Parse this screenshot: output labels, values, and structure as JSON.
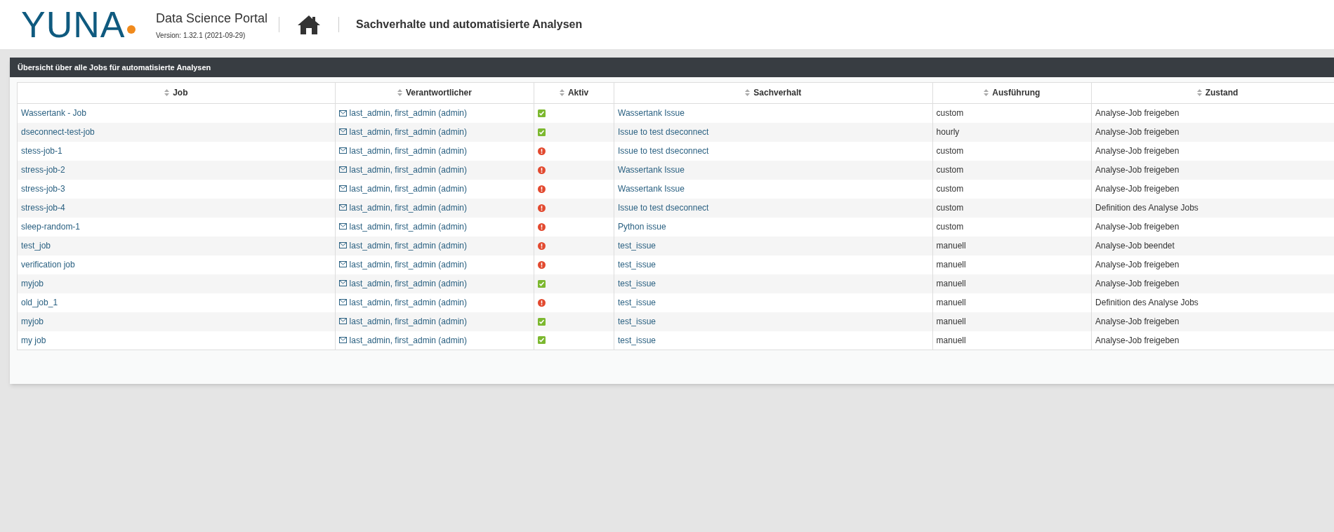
{
  "header": {
    "logo": "YUNA",
    "app_name": "Data Science Portal",
    "version": "Version: 1.32.1 (2021-09-29)",
    "page_title": "Sachverhalte und automatisierte Analysen"
  },
  "panel": {
    "title": "Übersicht über alle Jobs für automatisierte Analysen",
    "columns": [
      "Job",
      "Verantwortlicher",
      "Aktiv",
      "Sachverhalt",
      "Ausführung",
      "Zustand"
    ],
    "rows": [
      {
        "job": "Wassertank - Job",
        "owner": "last_admin, first_admin (admin)",
        "active": true,
        "issue": "Wassertank Issue",
        "execution": "custom",
        "state": "Analyse-Job freigeben"
      },
      {
        "job": "dseconnect-test-job",
        "owner": "last_admin, first_admin (admin)",
        "active": true,
        "issue": "Issue to test dseconnect",
        "execution": "hourly",
        "state": "Analyse-Job freigeben"
      },
      {
        "job": "stess-job-1",
        "owner": "last_admin, first_admin (admin)",
        "active": false,
        "issue": "Issue to test dseconnect",
        "execution": "custom",
        "state": "Analyse-Job freigeben"
      },
      {
        "job": "stress-job-2",
        "owner": "last_admin, first_admin (admin)",
        "active": false,
        "issue": "Wassertank Issue",
        "execution": "custom",
        "state": "Analyse-Job freigeben"
      },
      {
        "job": "stress-job-3",
        "owner": "last_admin, first_admin (admin)",
        "active": false,
        "issue": "Wassertank Issue",
        "execution": "custom",
        "state": "Analyse-Job freigeben"
      },
      {
        "job": "stress-job-4",
        "owner": "last_admin, first_admin (admin)",
        "active": false,
        "issue": "Issue to test dseconnect",
        "execution": "custom",
        "state": "Definition des Analyse Jobs"
      },
      {
        "job": "sleep-random-1",
        "owner": "last_admin, first_admin (admin)",
        "active": false,
        "issue": "Python issue",
        "execution": "custom",
        "state": "Analyse-Job freigeben"
      },
      {
        "job": "test_job",
        "owner": "last_admin, first_admin (admin)",
        "active": false,
        "issue": "test_issue",
        "execution": "manuell",
        "state": "Analyse-Job beendet"
      },
      {
        "job": "verification job",
        "owner": "last_admin, first_admin (admin)",
        "active": false,
        "issue": "test_issue",
        "execution": "manuell",
        "state": "Analyse-Job freigeben"
      },
      {
        "job": "myjob",
        "owner": "last_admin, first_admin (admin)",
        "active": true,
        "issue": "test_issue",
        "execution": "manuell",
        "state": "Analyse-Job freigeben"
      },
      {
        "job": "old_job_1",
        "owner": "last_admin, first_admin (admin)",
        "active": false,
        "issue": "test_issue",
        "execution": "manuell",
        "state": "Definition des Analyse Jobs"
      },
      {
        "job": "myjob",
        "owner": "last_admin, first_admin (admin)",
        "active": true,
        "issue": "test_issue",
        "execution": "manuell",
        "state": "Analyse-Job freigeben"
      },
      {
        "job": "my job",
        "owner": "last_admin, first_admin (admin)",
        "active": true,
        "issue": "test_issue",
        "execution": "manuell",
        "state": "Analyse-Job freigeben"
      }
    ]
  }
}
